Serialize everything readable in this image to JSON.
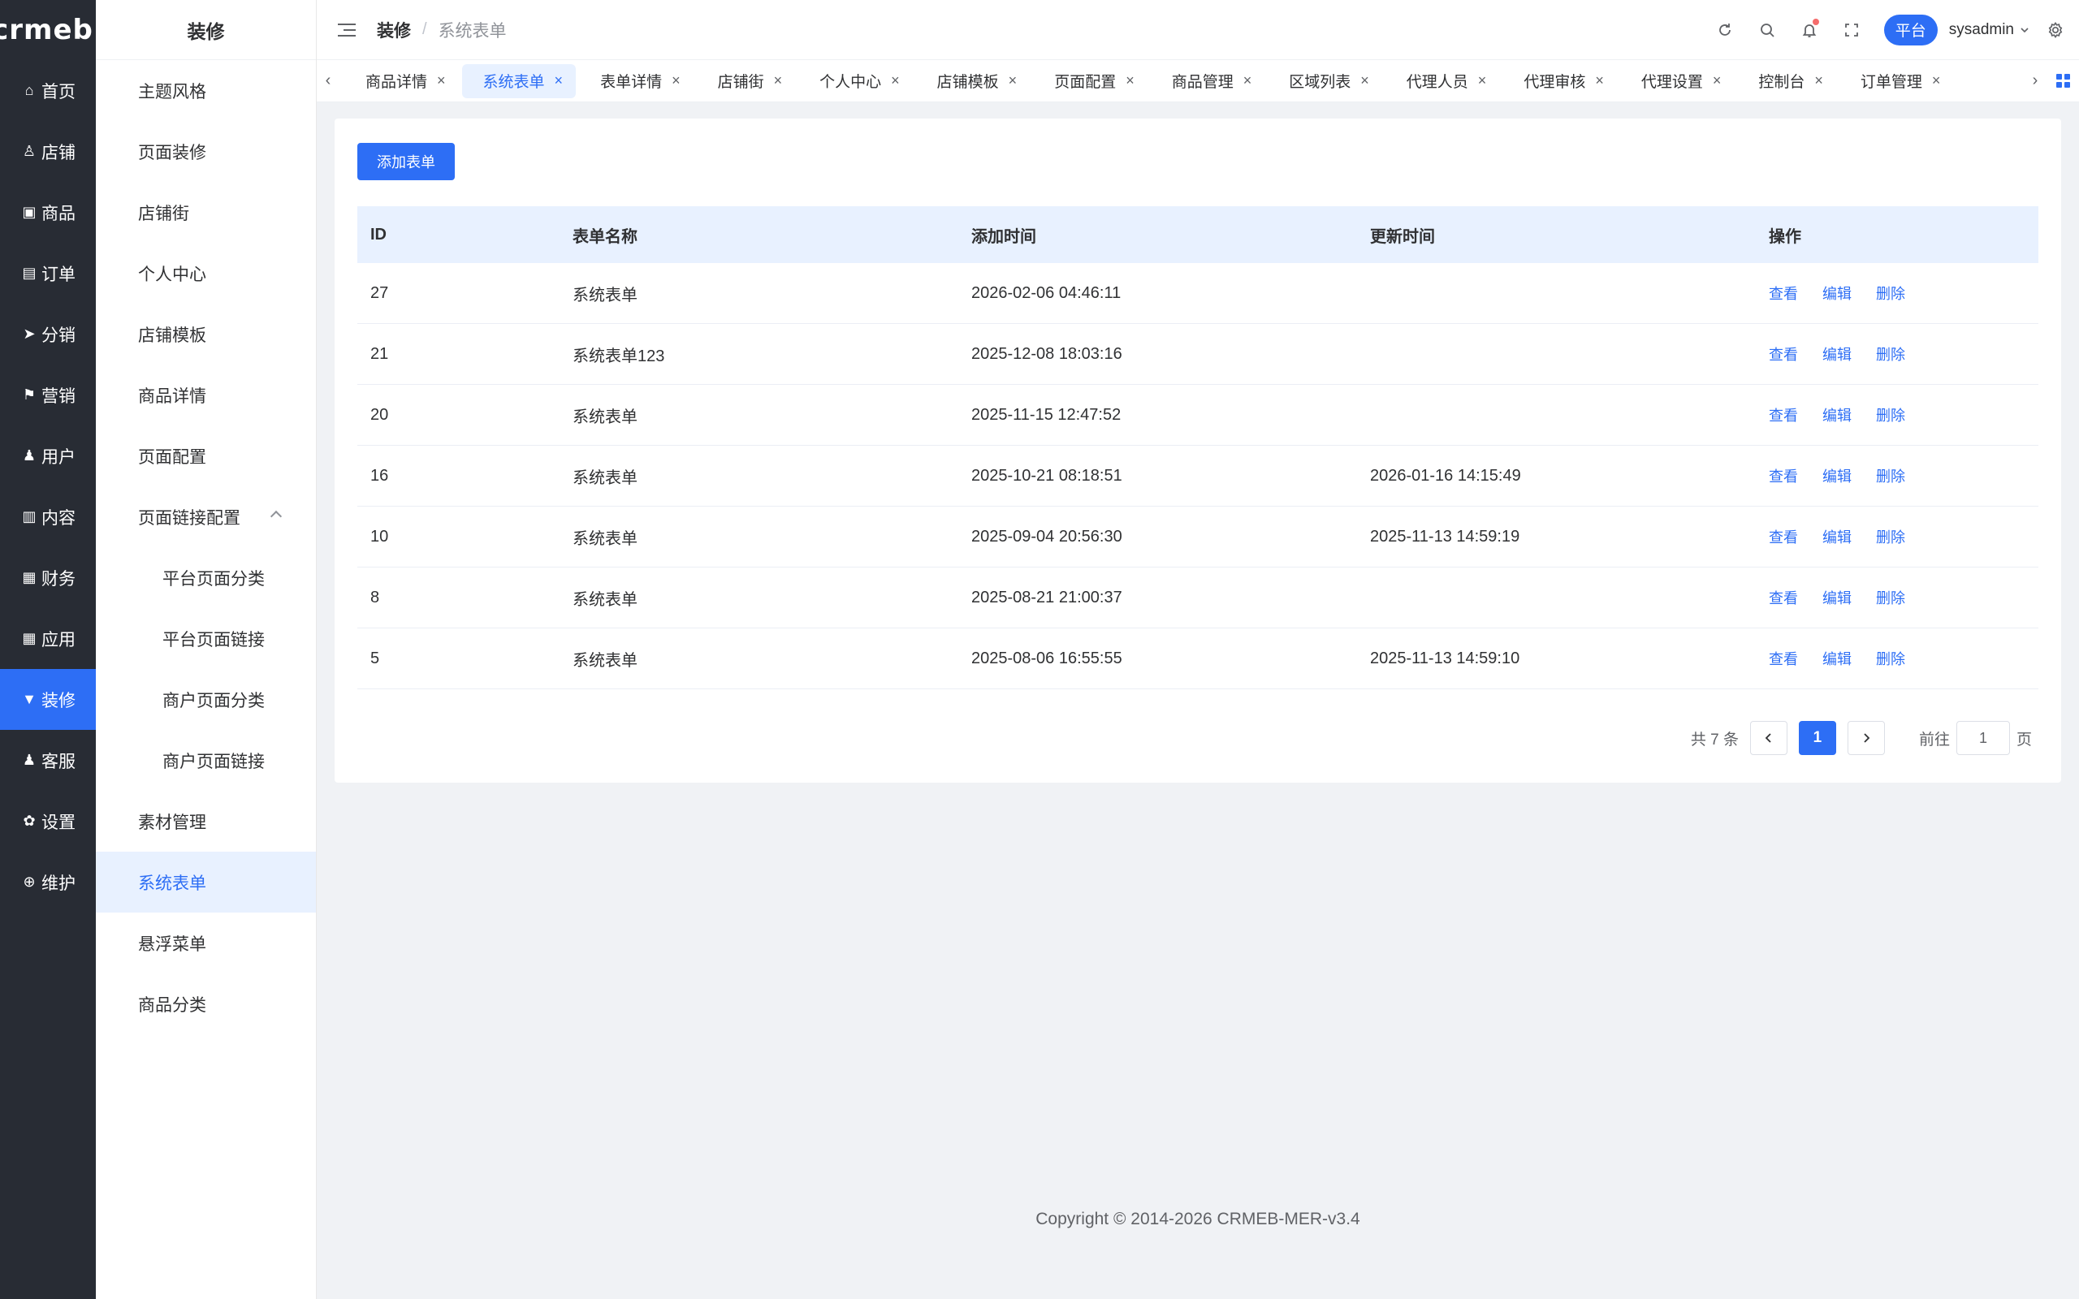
{
  "brand": {
    "logo_text": "crmeb",
    "logo_mark": "®"
  },
  "rail": {
    "items": [
      {
        "label": "首页",
        "icon": "home-icon",
        "glyph": "⌂"
      },
      {
        "label": "店铺",
        "icon": "store-icon",
        "glyph": "♙"
      },
      {
        "label": "商品",
        "icon": "bag-icon",
        "glyph": "▣"
      },
      {
        "label": "订单",
        "icon": "clipboard-icon",
        "glyph": "▤"
      },
      {
        "label": "分销",
        "icon": "send-icon",
        "glyph": "➤"
      },
      {
        "label": "营销",
        "icon": "flag-icon",
        "glyph": "⚑"
      },
      {
        "label": "用户",
        "icon": "user-icon",
        "glyph": "♟"
      },
      {
        "label": "内容",
        "icon": "book-icon",
        "glyph": "▥"
      },
      {
        "label": "财务",
        "icon": "bar-chart-icon",
        "glyph": "▦"
      },
      {
        "label": "应用",
        "icon": "apps-grid-icon",
        "glyph": "▦"
      },
      {
        "label": "装修",
        "icon": "brush-icon",
        "glyph": "▼"
      },
      {
        "label": "客服",
        "icon": "support-icon",
        "glyph": "♟"
      },
      {
        "label": "设置",
        "icon": "gear-icon",
        "glyph": "✿"
      },
      {
        "label": "维护",
        "icon": "plus-circle-icon",
        "glyph": "⊕"
      }
    ],
    "active_index": 10
  },
  "submenu": {
    "title": "装修",
    "items": [
      {
        "label": "主题风格"
      },
      {
        "label": "页面装修"
      },
      {
        "label": "店铺街"
      },
      {
        "label": "个人中心"
      },
      {
        "label": "店铺模板"
      },
      {
        "label": "商品详情"
      },
      {
        "label": "页面配置"
      },
      {
        "label": "页面链接配置"
      },
      {
        "label": "平台页面分类"
      },
      {
        "label": "平台页面链接"
      },
      {
        "label": "商户页面分类"
      },
      {
        "label": "商户页面链接"
      },
      {
        "label": "素材管理"
      },
      {
        "label": "系统表单"
      },
      {
        "label": "悬浮菜单"
      },
      {
        "label": "商品分类"
      }
    ]
  },
  "header": {
    "breadcrumb_parent": "装修",
    "breadcrumb_sep": "/",
    "breadcrumb_current": "系统表单",
    "platform_label": "平台",
    "username": "sysadmin"
  },
  "tabs": {
    "items": [
      {
        "label": "商品详情"
      },
      {
        "label": "系统表单"
      },
      {
        "label": "表单详情"
      },
      {
        "label": "店铺街"
      },
      {
        "label": "个人中心"
      },
      {
        "label": "店铺模板"
      },
      {
        "label": "页面配置"
      },
      {
        "label": "商品管理"
      },
      {
        "label": "区域列表"
      },
      {
        "label": "代理人员"
      },
      {
        "label": "代理审核"
      },
      {
        "label": "代理设置"
      },
      {
        "label": "控制台"
      },
      {
        "label": "订单管理"
      }
    ],
    "active_index": 1,
    "close_glyph": "×"
  },
  "main": {
    "add_button": "添加表单",
    "columns": {
      "id": "ID",
      "name": "表单名称",
      "created": "添加时间",
      "updated": "更新时间",
      "actions": "操作"
    },
    "actions": {
      "view": "查看",
      "edit": "编辑",
      "delete": "删除"
    },
    "rows": [
      {
        "id": "27",
        "name": "系统表单",
        "created": "2026-02-06 04:46:11",
        "updated": ""
      },
      {
        "id": "21",
        "name": "系统表单123",
        "created": "2025-12-08 18:03:16",
        "updated": ""
      },
      {
        "id": "20",
        "name": "系统表单",
        "created": "2025-11-15 12:47:52",
        "updated": ""
      },
      {
        "id": "16",
        "name": "系统表单",
        "created": "2025-10-21 08:18:51",
        "updated": "2026-01-16 14:15:49"
      },
      {
        "id": "10",
        "name": "系统表单",
        "created": "2025-09-04 20:56:30",
        "updated": "2025-11-13 14:59:19"
      },
      {
        "id": "8",
        "name": "系统表单",
        "created": "2025-08-21 21:00:37",
        "updated": ""
      },
      {
        "id": "5",
        "name": "系统表单",
        "created": "2025-08-06 16:55:55",
        "updated": "2025-11-13 14:59:10"
      }
    ],
    "pagination": {
      "total_text": "共 7 条",
      "current_page": "1",
      "goto_prefix": "前往",
      "goto_value": "1",
      "goto_suffix": "页"
    }
  },
  "footer": {
    "copyright": "Copyright © 2014-2026 CRMEB-MER-v3.4"
  },
  "colors": {
    "accent": "#2d6ef5",
    "rail_bg": "#282c34",
    "active_bg": "#e8f1ff"
  }
}
